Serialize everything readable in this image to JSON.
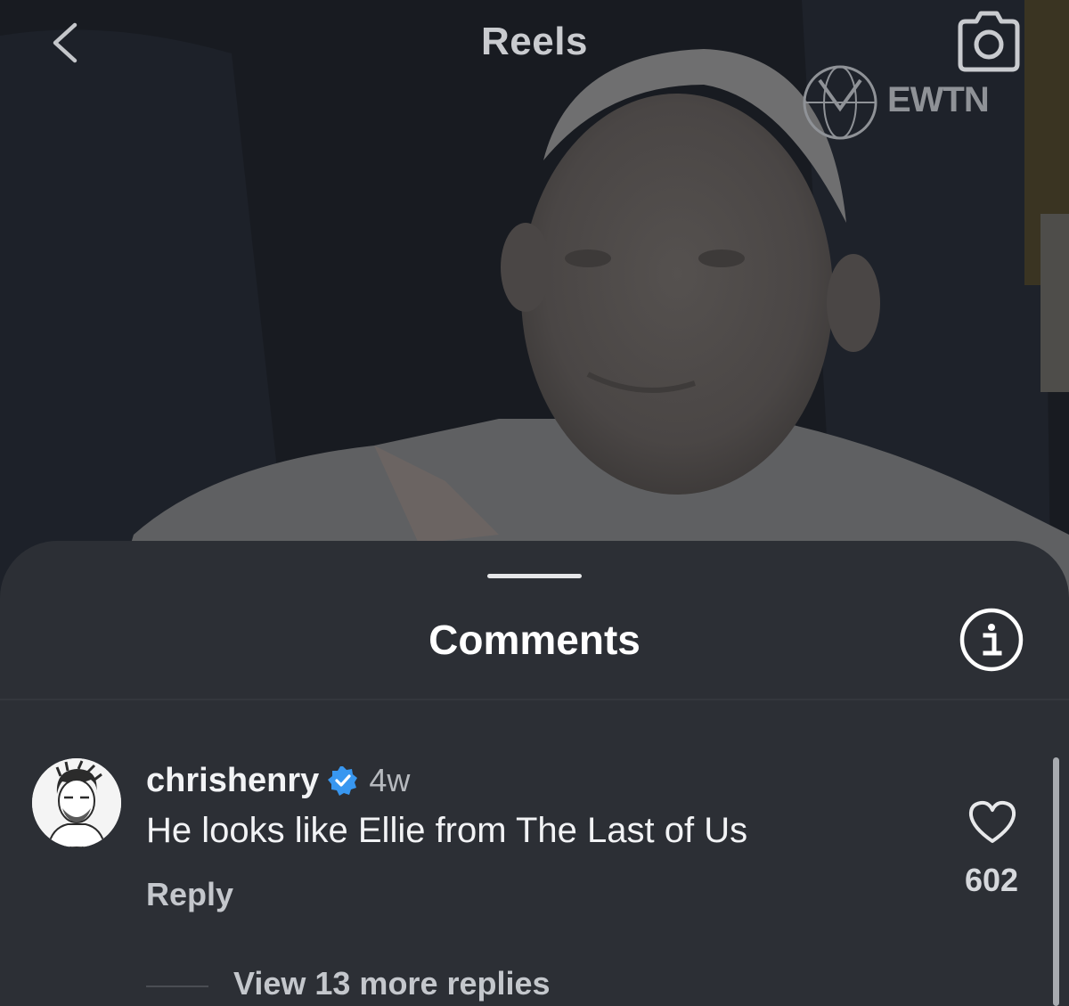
{
  "top_bar": {
    "title": "Reels",
    "back_icon": "chevron-left-icon",
    "camera_icon": "camera-icon"
  },
  "video": {
    "watermark": "EWTN"
  },
  "comments_sheet": {
    "title": "Comments",
    "info_icon": "info-icon",
    "background_color": "#2c2f35"
  },
  "comment": {
    "username": "chrishenry",
    "verified": true,
    "verified_color": "#3897f0",
    "timestamp": "4w",
    "text": "He looks like Ellie from The Last of Us",
    "reply_label": "Reply",
    "like_count": "602",
    "view_replies_label": "View 13 more replies"
  }
}
